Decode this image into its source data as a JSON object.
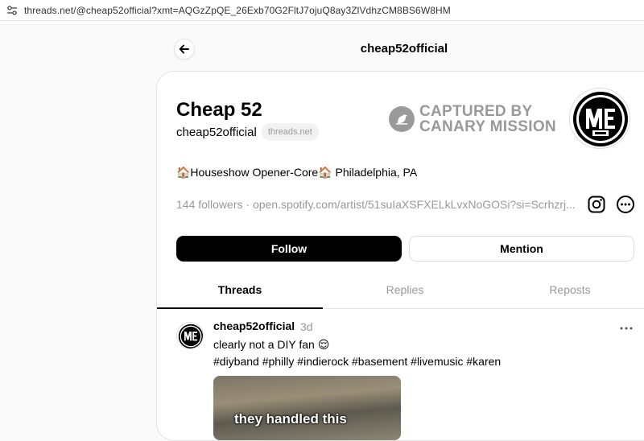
{
  "browser": {
    "url": "threads.net/@cheap52official?xmt=AQGzZpQE_26Exb70G2FltJ7ojuQ8ay3ZlVdhzCM8BS6W8HM"
  },
  "topbar": {
    "title": "cheap52official"
  },
  "profile": {
    "display_name": "Cheap 52",
    "handle": "cheap52official",
    "domain_chip": "threads.net",
    "stamp_line1": "CAPTURED BY",
    "stamp_line2": "CANARY MISSION",
    "bio": "🏠Houseshow Opener-Core🏠 Philadelphia, PA",
    "followers": "144 followers",
    "separator": " · ",
    "link": "open.spotify.com/artist/51suIaXSFXELkLvxNoGOSi?si=Scrhzrj..."
  },
  "actions": {
    "follow_label": "Follow",
    "mention_label": "Mention"
  },
  "tabs": [
    {
      "label": "Threads",
      "active": true
    },
    {
      "label": "Replies",
      "active": false
    },
    {
      "label": "Reposts",
      "active": false
    }
  ],
  "post": {
    "author": "cheap52official",
    "time": "3d",
    "text": "clearly not a DIY fan 😌",
    "tags": "#diyband #philly #indierock #basement #livemusic #karen",
    "media_caption": "they handled this"
  },
  "icons": {
    "url_settings": "tune-icon",
    "back": "arrow-left-icon",
    "stamp": "canary-bird-icon",
    "instagram": "instagram-icon",
    "more": "more-circle-icon",
    "post_more": "ellipsis-icon"
  }
}
